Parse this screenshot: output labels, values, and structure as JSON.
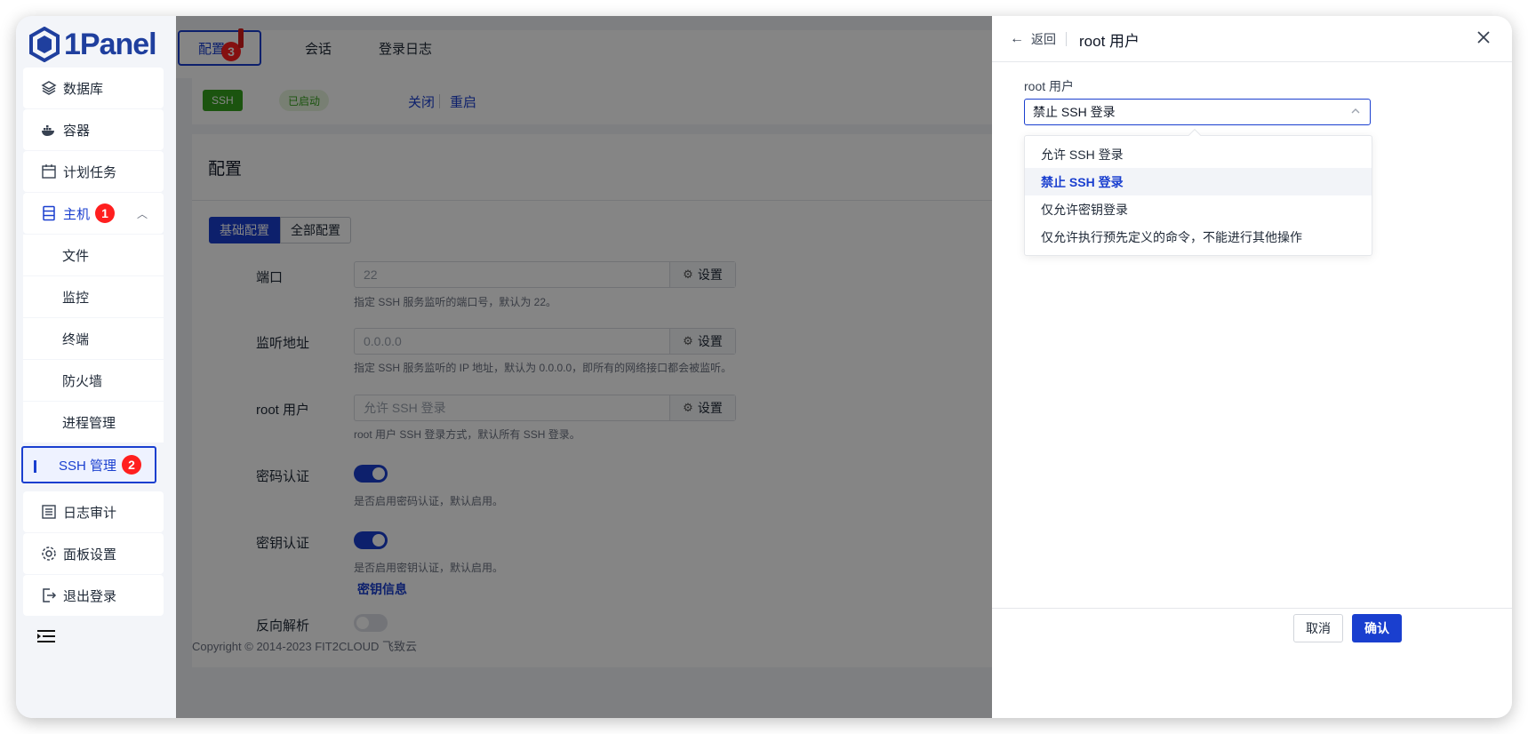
{
  "app": {
    "name": "1Panel"
  },
  "sidebar": {
    "items": [
      {
        "label": "数据库",
        "icon": "database-icon"
      },
      {
        "label": "容器",
        "icon": "docker-icon"
      },
      {
        "label": "计划任务",
        "icon": "calendar-icon"
      },
      {
        "label": "主机",
        "icon": "server-icon",
        "badge": "1"
      }
    ],
    "host_children": [
      "文件",
      "监控",
      "终端",
      "防火墙",
      "进程管理"
    ],
    "active_child": {
      "label": "SSH 管理",
      "badge": "2"
    },
    "bottom_items": [
      {
        "label": "日志审计",
        "icon": "log-icon"
      },
      {
        "label": "面板设置",
        "icon": "gear-icon"
      },
      {
        "label": "退出登录",
        "icon": "logout-icon"
      }
    ]
  },
  "tabs": [
    {
      "label": "配置",
      "badge": "3"
    },
    {
      "label": "会话"
    },
    {
      "label": "登录日志"
    }
  ],
  "status": {
    "service": "SSH",
    "state": "已启动",
    "stop": "关闭",
    "restart": "重启"
  },
  "config": {
    "title": "配置",
    "segments": [
      "基础配置",
      "全部配置"
    ],
    "set_label": "设置",
    "port": {
      "label": "端口",
      "value": "22",
      "hint": "指定 SSH 服务监听的端口号，默认为 22。"
    },
    "listen": {
      "label": "监听地址",
      "value": "0.0.0.0",
      "hint": "指定 SSH 服务监听的 IP 地址，默认为 0.0.0.0，即所有的网络接口都会被监听。"
    },
    "root": {
      "label": "root 用户",
      "value": "允许 SSH 登录",
      "hint": "root 用户 SSH 登录方式，默认所有 SSH 登录。"
    },
    "password_auth": {
      "label": "密码认证",
      "enabled": true,
      "hint": "是否启用密码认证，默认启用。"
    },
    "key_auth": {
      "label": "密钥认证",
      "enabled": true,
      "hint": "是否启用密钥认证，默认启用。",
      "link": "密钥信息"
    },
    "reverse_dns": {
      "label": "反向解析",
      "enabled": false
    }
  },
  "footer": {
    "copyright": "Copyright © 2014-2023 FIT2CLOUD 飞致云"
  },
  "drawer": {
    "back": "返回",
    "title": "root 用户",
    "field_label": "root 用户",
    "selected": "禁止 SSH 登录",
    "options": [
      "允许 SSH 登录",
      "禁止 SSH 登录",
      "仅允许密钥登录",
      "仅允许执行预先定义的命令，不能进行其他操作"
    ],
    "cancel": "取消",
    "confirm": "确认"
  },
  "colors": {
    "primary": "#1a3fcf",
    "success": "#35a11d",
    "badge": "#ff1f1f"
  }
}
